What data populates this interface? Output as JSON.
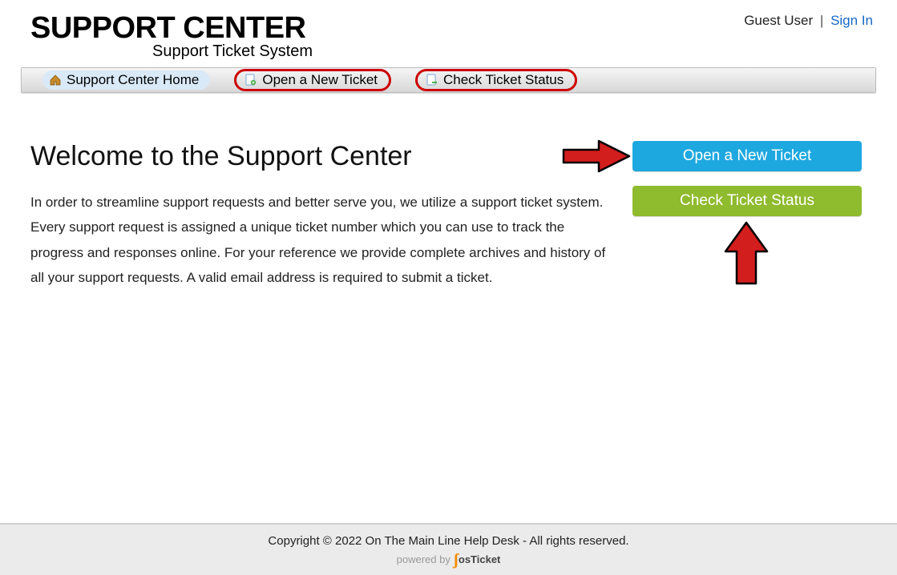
{
  "brand": {
    "title": "SUPPORT CENTER",
    "subtitle": "Support Ticket System"
  },
  "user": {
    "guest_label": "Guest User",
    "separator": "|",
    "signin_label": "Sign In"
  },
  "nav": {
    "home": "Support Center Home",
    "open_new": "Open a New Ticket",
    "check_status": "Check Ticket Status"
  },
  "main": {
    "welcome": "Welcome to the Support Center",
    "intro": "In order to streamline support requests and better serve you, we utilize a support ticket system. Every support request is assigned a unique ticket number which you can use to track the progress and responses online. For your reference we provide complete archives and history of all your support requests. A valid email address is required to submit a ticket."
  },
  "cta": {
    "open": "Open a New Ticket",
    "check": "Check Ticket Status"
  },
  "footer": {
    "copyright": "Copyright © 2022 On The Main Line Help Desk - All rights reserved.",
    "powered_prefix": "powered by",
    "powered_brand_tail": "Ticket"
  }
}
